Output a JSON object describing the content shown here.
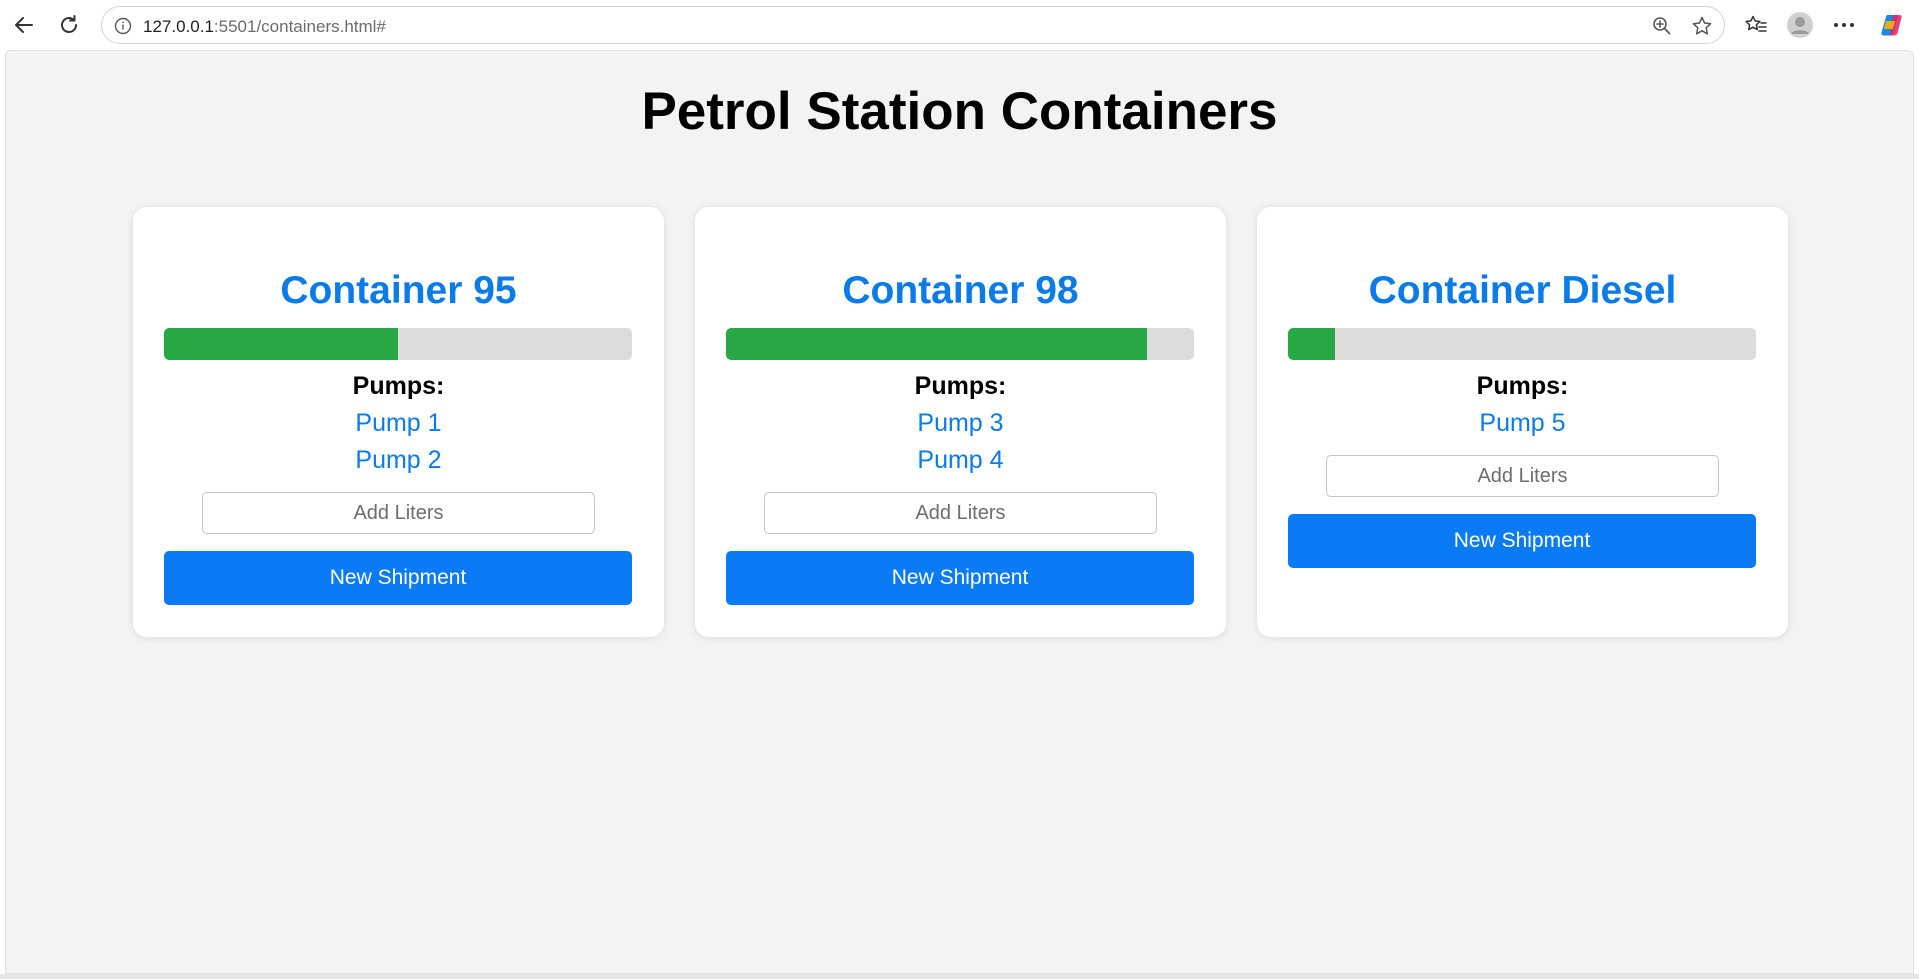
{
  "browser": {
    "url_host": "127.0.0.1",
    "url_rest": ":5501/containers.html#"
  },
  "page": {
    "title": "Petrol Station Containers"
  },
  "containers": [
    {
      "title": "Container 95",
      "fill_percent": 50,
      "pumps_label": "Pumps:",
      "pumps": [
        "Pump 1",
        "Pump 2"
      ],
      "input_placeholder": "Add Liters",
      "button_label": "New Shipment"
    },
    {
      "title": "Container 98",
      "fill_percent": 90,
      "pumps_label": "Pumps:",
      "pumps": [
        "Pump 3",
        "Pump 4"
      ],
      "input_placeholder": "Add Liters",
      "button_label": "New Shipment"
    },
    {
      "title": "Container Diesel",
      "fill_percent": 10,
      "pumps_label": "Pumps:",
      "pumps": [
        "Pump 5"
      ],
      "input_placeholder": "Add Liters",
      "button_label": "New Shipment"
    }
  ],
  "colors": {
    "accent": "#0b7be8",
    "button": "#0a7bf5",
    "progress_fill": "#28a745",
    "progress_track": "#dcdcdc",
    "page_bg": "#f3f3f3"
  }
}
